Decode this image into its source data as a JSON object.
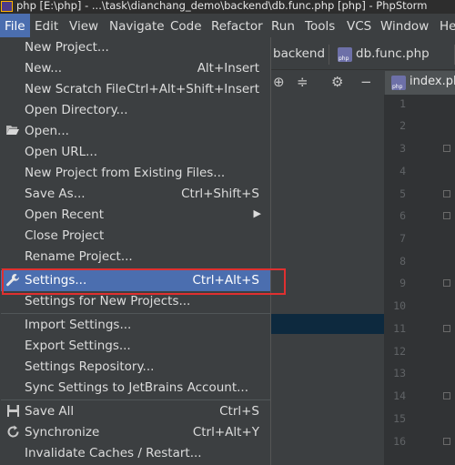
{
  "window": {
    "title": "php [E:\\php] - ...\\task\\dianchang_demo\\backend\\db.func.php [php] - PhpStorm"
  },
  "menubar": {
    "items": [
      {
        "label": "File",
        "mnemonic": "F"
      },
      {
        "label": "Edit",
        "mnemonic": "E"
      },
      {
        "label": "View",
        "mnemonic": "V"
      },
      {
        "label": "Navigate",
        "mnemonic": "N"
      },
      {
        "label": "Code",
        "mnemonic": "C"
      },
      {
        "label": "Refactor",
        "mnemonic": "R"
      },
      {
        "label": "Run",
        "mnemonic": "u"
      },
      {
        "label": "Tools",
        "mnemonic": "T"
      },
      {
        "label": "VCS",
        "mnemonic": "S"
      },
      {
        "label": "Window",
        "mnemonic": "W"
      },
      {
        "label": "He",
        "mnemonic": ""
      }
    ]
  },
  "breadcrumb": {
    "folder": "backend",
    "file": "db.func.php"
  },
  "editor_tab": {
    "label": "index.ph"
  },
  "gutter": {
    "line_numbers": [
      "1",
      "2",
      "3",
      "4",
      "5",
      "6",
      "7",
      "8",
      "9",
      "10",
      "11",
      "12",
      "13",
      "14",
      "15",
      "16"
    ]
  },
  "file_menu": {
    "items": [
      {
        "label": "New Project...",
        "shortcut": ""
      },
      {
        "label": "New...",
        "shortcut": "Alt+Insert"
      },
      {
        "label": "New Scratch File",
        "shortcut": "Ctrl+Alt+Shift+Insert"
      },
      {
        "label": "Open Directory...",
        "shortcut": ""
      },
      {
        "label": "Open...",
        "shortcut": "",
        "icon": "folder-open-icon"
      },
      {
        "label": "Open URL...",
        "shortcut": ""
      },
      {
        "label": "New Project from Existing Files...",
        "shortcut": ""
      },
      {
        "label": "Save As...",
        "shortcut": "Ctrl+Shift+S"
      },
      {
        "label": "Open Recent",
        "shortcut": "",
        "submenu": true
      },
      {
        "label": "Close Project",
        "shortcut": ""
      },
      {
        "label": "Rename Project...",
        "shortcut": ""
      },
      {
        "label": "Settings...",
        "shortcut": "Ctrl+Alt+S",
        "icon": "wrench-icon",
        "selected": true
      },
      {
        "label": "Settings for New Projects...",
        "shortcut": ""
      },
      {
        "label": "Import Settings...",
        "shortcut": ""
      },
      {
        "label": "Export Settings...",
        "shortcut": ""
      },
      {
        "label": "Settings Repository...",
        "shortcut": ""
      },
      {
        "label": "Sync Settings to JetBrains Account...",
        "shortcut": ""
      },
      {
        "label": "Save All",
        "shortcut": "Ctrl+S",
        "icon": "save-icon"
      },
      {
        "label": "Synchronize",
        "shortcut": "Ctrl+Alt+Y",
        "icon": "sync-icon"
      },
      {
        "label": "Invalidate Caches / Restart...",
        "shortcut": ""
      }
    ]
  },
  "colors": {
    "menu_bg": "#3c3f41",
    "selection": "#4b6eaf",
    "highlight_box": "#e03030",
    "editor_bg": "#2b2b2b"
  }
}
